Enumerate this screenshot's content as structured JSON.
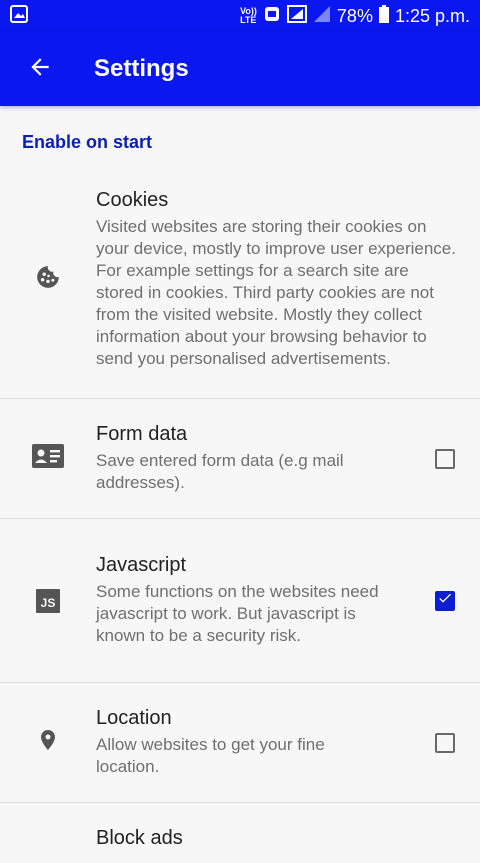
{
  "status_bar": {
    "network": "VoLTE",
    "battery": "78%",
    "time": "1:25 p.m."
  },
  "app_bar": {
    "title": "Settings",
    "back_icon": "arrow-left-icon"
  },
  "section": {
    "title": "Enable on start"
  },
  "preferences": [
    {
      "title": "Cookies",
      "summary": "Visited websites are storing their cookies on your device, mostly to improve user experience. For example settings for a search site are stored in cookies. Third party cookies are not from the visited website. Mostly they collect information about your browsing behavior to send you personalised advertisements.",
      "icon": "cookie-icon"
    },
    {
      "title": "Form data",
      "summary": "Save entered form data (e.g mail addresses).",
      "icon": "contact-card-icon",
      "checked": false
    },
    {
      "title": "Javascript",
      "summary": "Some functions on the websites need javascript to work. But javascript is known to be a security risk.",
      "icon": "js-icon",
      "icon_text": "JS",
      "checked": true
    },
    {
      "title": "Location",
      "summary": "Allow websites to get your fine location.",
      "icon": "location-pin-icon",
      "checked": false
    },
    {
      "title": "Block ads"
    }
  ],
  "colors": {
    "primary": "#0a17f0",
    "accent": "#0b1fd1",
    "section_header": "#0b1fb3"
  }
}
